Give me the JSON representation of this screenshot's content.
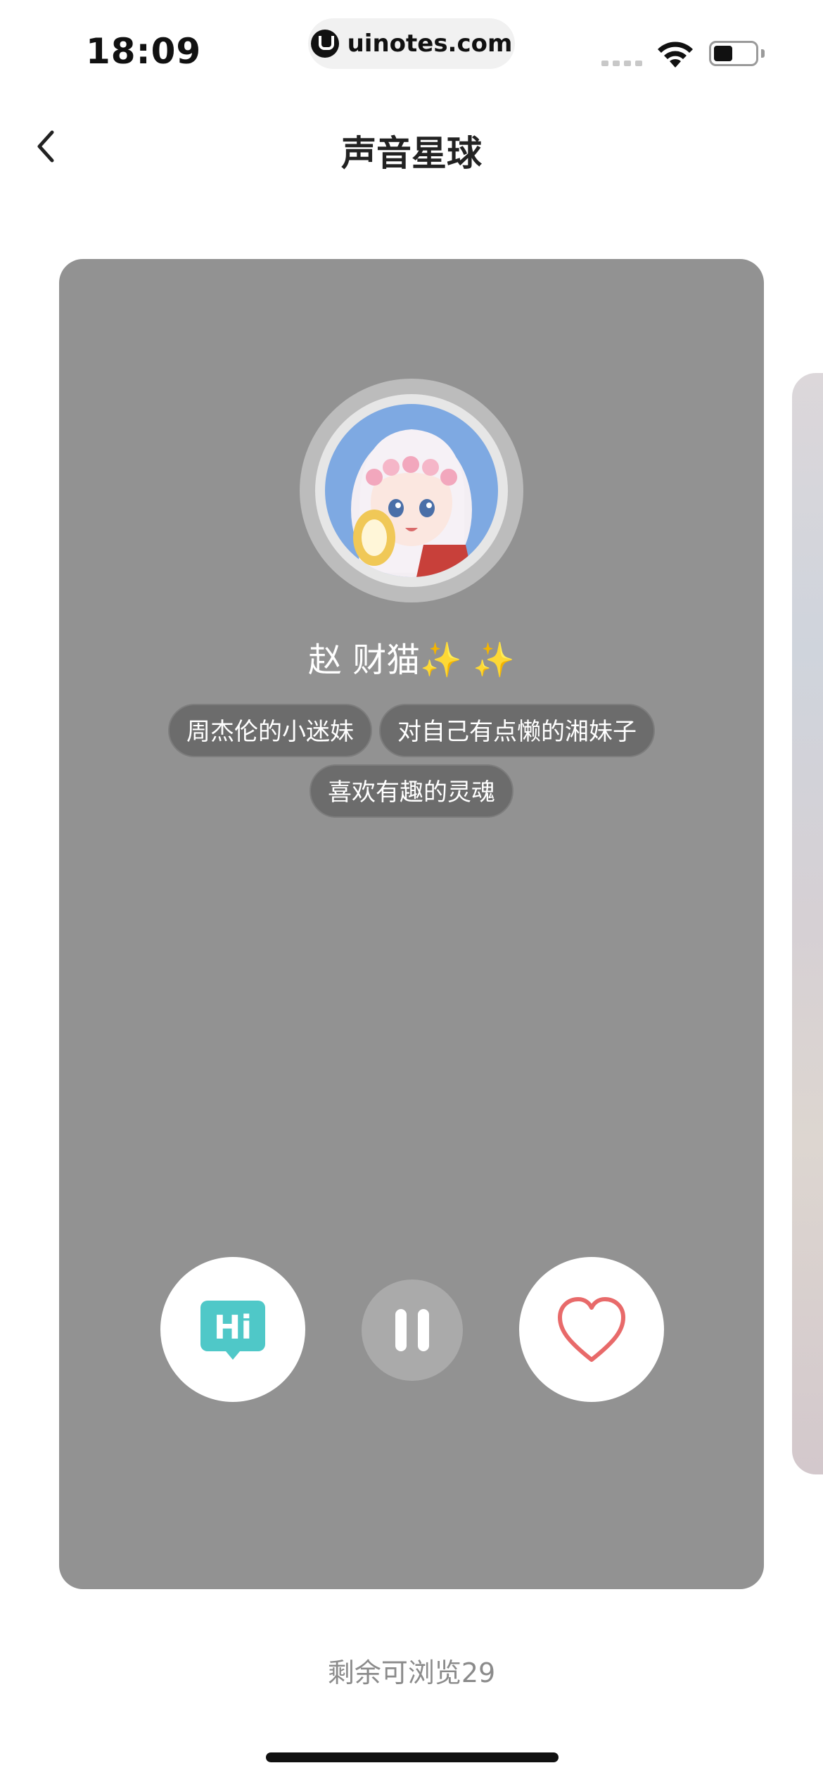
{
  "status_bar": {
    "time": "18:09",
    "url": "uinotes.com",
    "icons": [
      "signal-icon",
      "wifi-icon",
      "battery-icon"
    ]
  },
  "nav": {
    "title": "声音星球",
    "back_icon": "chevron-left-icon"
  },
  "profile": {
    "name": "赵  财猫✨ ✨",
    "tags": [
      "周杰伦的小迷妹",
      "对自己有点懒的湘妹子",
      "喜欢有趣的灵魂"
    ]
  },
  "actions": {
    "hi_label": "Hi",
    "hi_icon": "hi-chat-icon",
    "pause_icon": "pause-icon",
    "like_icon": "heart-icon"
  },
  "footer": {
    "remaining_text": "剩余可浏览29"
  },
  "colors": {
    "card_bg": "#929292",
    "tag_bg": "#6c6c6c",
    "hi_accent": "#4fc8c8",
    "heart": "#e86a6a"
  }
}
